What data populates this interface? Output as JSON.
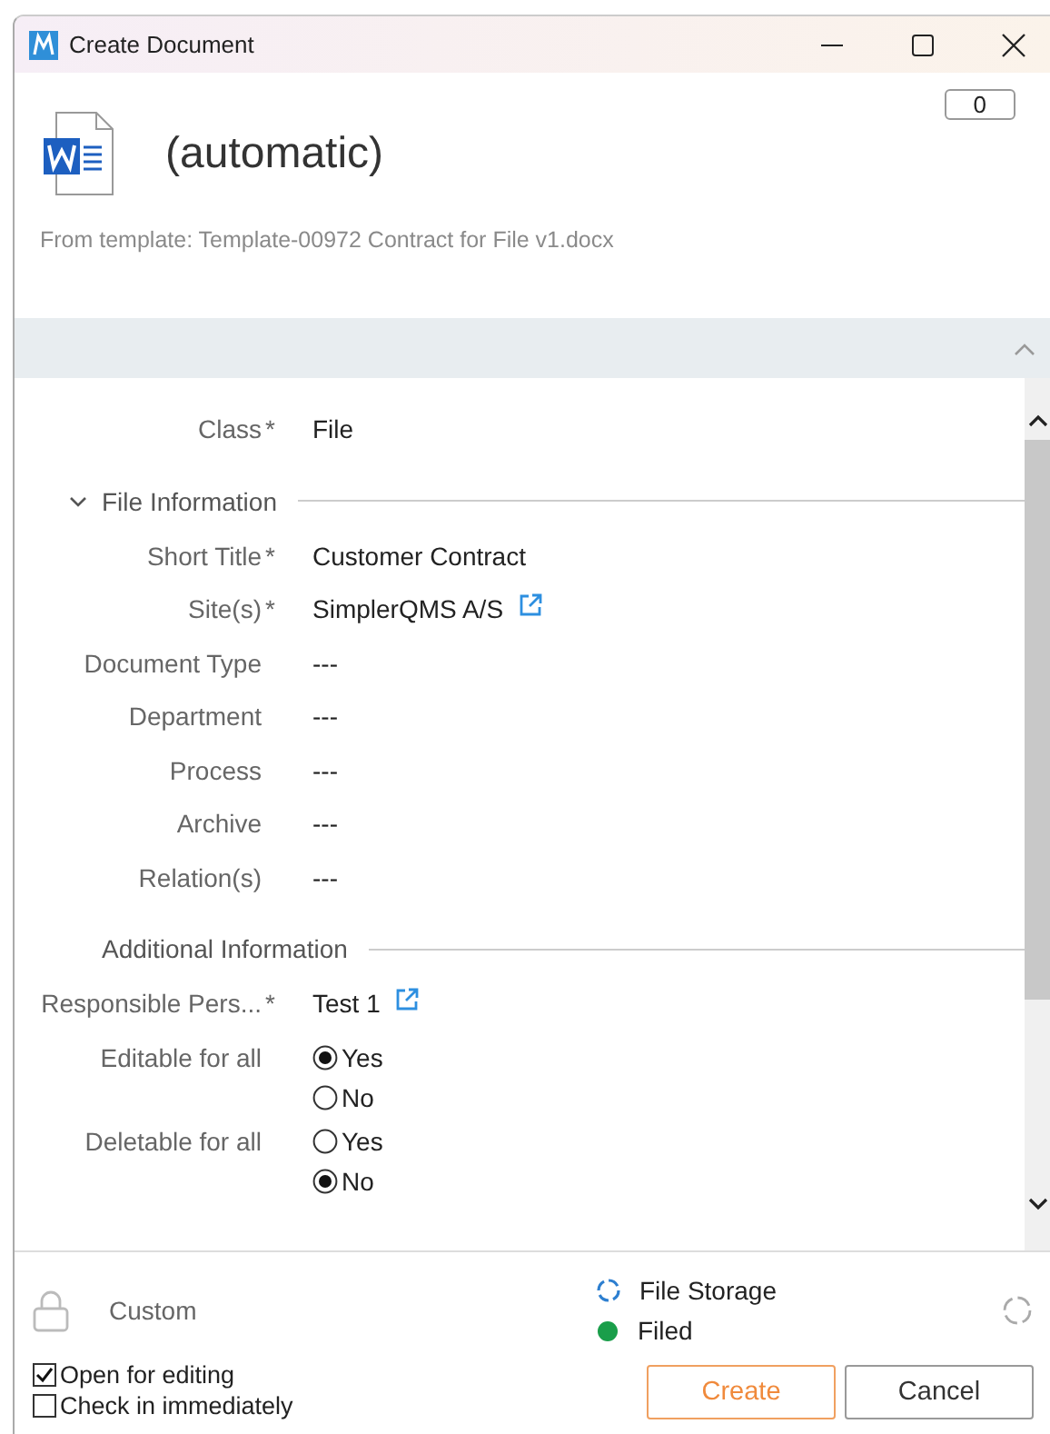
{
  "window": {
    "title": "Create Document"
  },
  "header": {
    "title": "(automatic)",
    "template": "From template: Template-00972 Contract for File v1.docx",
    "comment_count": "0"
  },
  "form": {
    "rows": [
      {
        "kind": "field",
        "label": "Class",
        "required_mark": "*",
        "value": "File"
      },
      {
        "kind": "section",
        "label": "File Information",
        "collapsible": true,
        "expanded": true
      },
      {
        "kind": "field",
        "label": "Short Title",
        "required_mark": "*",
        "value": "Customer Contract"
      },
      {
        "kind": "field",
        "label": "Site(s)",
        "required_mark": "*",
        "value": "SimplerQMS A/S",
        "link": true
      },
      {
        "kind": "field",
        "label": "Document Type",
        "value": "---"
      },
      {
        "kind": "field",
        "label": "Department",
        "value": "---"
      },
      {
        "kind": "field",
        "label": "Process",
        "value": "---"
      },
      {
        "kind": "field",
        "label": "Archive",
        "value": "---"
      },
      {
        "kind": "field",
        "label": "Relation(s)",
        "value": "---"
      },
      {
        "kind": "section",
        "label": "Additional Information",
        "collapsible": false
      },
      {
        "kind": "field",
        "label": "Responsible Pers...",
        "required_mark": "*",
        "value": "Test 1",
        "link": true
      },
      {
        "kind": "radio",
        "label": "Editable for all",
        "options": [
          {
            "label": "Yes",
            "selected": true
          },
          {
            "label": "No",
            "selected": false
          }
        ]
      },
      {
        "kind": "radio",
        "label": "Deletable for all",
        "options": [
          {
            "label": "Yes",
            "selected": false
          },
          {
            "label": "No",
            "selected": true
          }
        ]
      }
    ]
  },
  "footer": {
    "permission": "Custom",
    "storage": "File Storage",
    "state": {
      "label": "Filed",
      "color": "#1a9e4a"
    },
    "checkboxes": [
      {
        "label": "Open for editing",
        "checked": true
      },
      {
        "label": "Check in immediately",
        "checked": false
      }
    ],
    "buttons": [
      {
        "label": "Create",
        "kind": "primary"
      },
      {
        "label": "Cancel",
        "kind": "secondary"
      }
    ]
  }
}
